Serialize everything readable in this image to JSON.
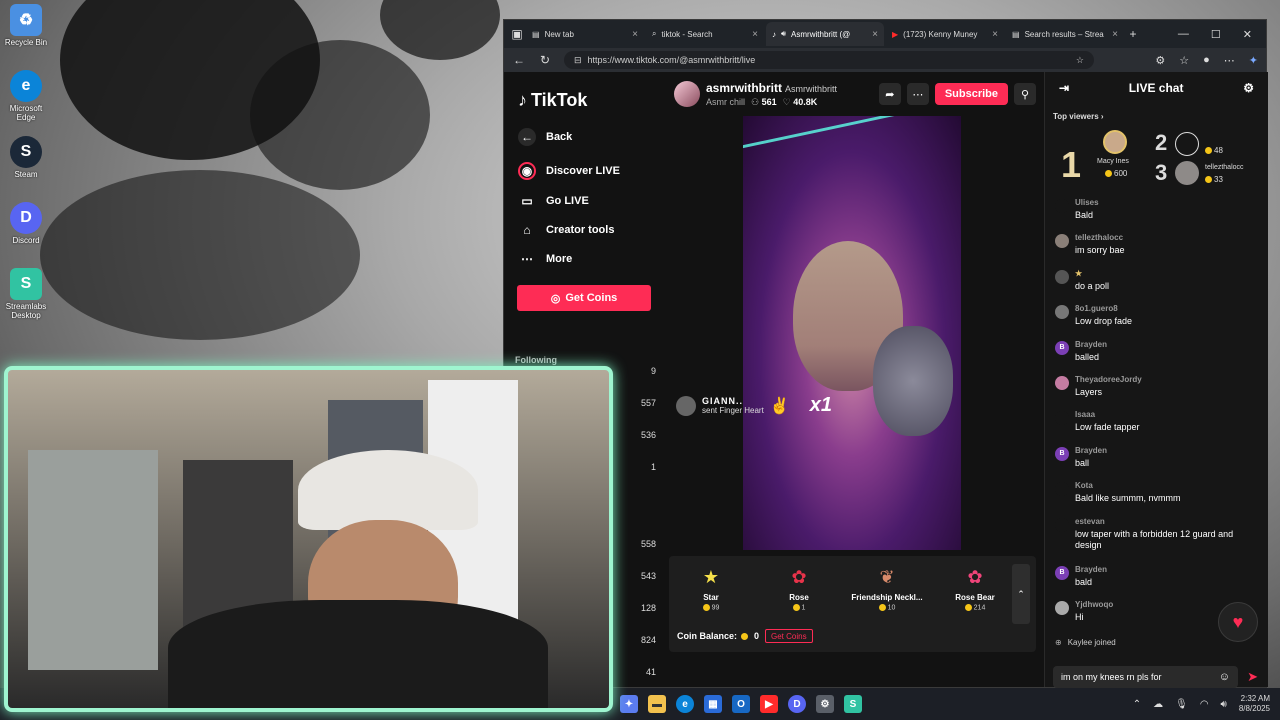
{
  "desktop": {
    "icons": [
      {
        "label": "Recycle Bin",
        "glyph": "♻",
        "color": "#4a90e2"
      },
      {
        "label": "Microsoft Edge",
        "glyph": "e",
        "color": "#0b84d8"
      },
      {
        "label": "Steam",
        "glyph": "S",
        "color": "#1b2838"
      },
      {
        "label": "Discord",
        "glyph": "D",
        "color": "#5865f2"
      },
      {
        "label": "Streamlabs Desktop",
        "glyph": "S",
        "color": "#31c3a2"
      }
    ]
  },
  "browser": {
    "tabs": [
      {
        "label": "New tab",
        "icon": "page-icon"
      },
      {
        "label": "tiktok - Search",
        "icon": "search-icon"
      },
      {
        "label": "Asmrwithbritt (@",
        "icon": "tiktok-icon",
        "active": true
      },
      {
        "label": "(1723) Kenny Muney",
        "icon": "youtube-icon"
      },
      {
        "label": "Search results – Strea",
        "icon": "page-icon"
      }
    ],
    "url": "https://www.tiktok.com/@asmrwithbritt/live"
  },
  "tiktok": {
    "logo": "TikTok",
    "nav": [
      {
        "label": "Back",
        "icon": "←"
      },
      {
        "label": "Discover LIVE",
        "icon": "◉"
      },
      {
        "label": "Go LIVE",
        "icon": "▭"
      },
      {
        "label": "Creator tools",
        "icon": "⌂"
      },
      {
        "label": "More",
        "icon": "⋯"
      }
    ],
    "get_coins": "Get Coins",
    "following_header": "Following",
    "following_counts": [
      "9",
      "557",
      "536",
      "1",
      "558",
      "543",
      "128",
      "824",
      "41"
    ]
  },
  "stream": {
    "username": "asmrwithbritt",
    "nickname": "Asmrwithbritt",
    "category": "Asmr chill",
    "viewers": "561",
    "likes": "40.8K",
    "subscribe": "Subscribe",
    "gift_alert": {
      "name": "GIANN..",
      "text": "sent Finger Heart",
      "count": "x1"
    }
  },
  "gifts": {
    "items": [
      {
        "name": "Star",
        "price": "99",
        "glyph": "★",
        "color": "#f5e04a"
      },
      {
        "name": "Rose",
        "price": "1",
        "glyph": "✿",
        "color": "#e8334a"
      },
      {
        "name": "Friendship Neckl...",
        "price": "10",
        "glyph": "❦",
        "color": "#d88a6a"
      },
      {
        "name": "Rose Bear",
        "price": "214",
        "glyph": "✿",
        "color": "#f0447a"
      }
    ],
    "balance_label": "Coin Balance:",
    "balance_value": "0",
    "get_coins": "Get Coins"
  },
  "chat": {
    "title": "LIVE chat",
    "top_viewers_label": "Top viewers",
    "top_viewers": [
      {
        "rank": "1",
        "name": "Macy Ines",
        "coins": "600"
      },
      {
        "rank": "2",
        "name": "",
        "coins": "48"
      },
      {
        "rank": "3",
        "name": "tellezthalocc",
        "coins": "33"
      }
    ],
    "messages": [
      {
        "user": "Ulises",
        "text": "Bald",
        "av": "#555",
        "letter": ""
      },
      {
        "user": "tellezthalocc",
        "text": "im sorry bae",
        "av": "#8a7",
        "letter": ""
      },
      {
        "user": "",
        "text": "do a poll",
        "av": "#444",
        "letter": ""
      },
      {
        "user": "8o1.guero8",
        "text": "Low drop fade",
        "av": "#777",
        "letter": ""
      },
      {
        "user": "Brayden",
        "text": "balled",
        "av": "#7b3fb5",
        "letter": "B"
      },
      {
        "user": "TheyadoreeJordy",
        "text": "Layers",
        "av": "#c57ca2",
        "letter": ""
      },
      {
        "user": "Isaaa",
        "text": "Low fade tapper",
        "av": "#161616",
        "letter": ""
      },
      {
        "user": "Brayden",
        "text": "ball",
        "av": "#7b3fb5",
        "letter": "B"
      },
      {
        "user": "Kota",
        "text": "Bald like summm, nvmmm",
        "av": "#161616",
        "letter": ""
      },
      {
        "user": "estevan",
        "text": "low taper with a forbidden 12 guard and design",
        "av": "#161616",
        "letter": ""
      },
      {
        "user": "Brayden",
        "text": "bald",
        "av": "#7b3fb5",
        "letter": "B"
      },
      {
        "user": "Yjdhwoqo",
        "text": "Hi",
        "av": "#aaa",
        "letter": ""
      }
    ],
    "joined": "Kaylee joined",
    "input_value": "im on my knees rn pls for"
  },
  "taskbar": {
    "time": "2:32 AM",
    "date": "8/8/2025"
  }
}
